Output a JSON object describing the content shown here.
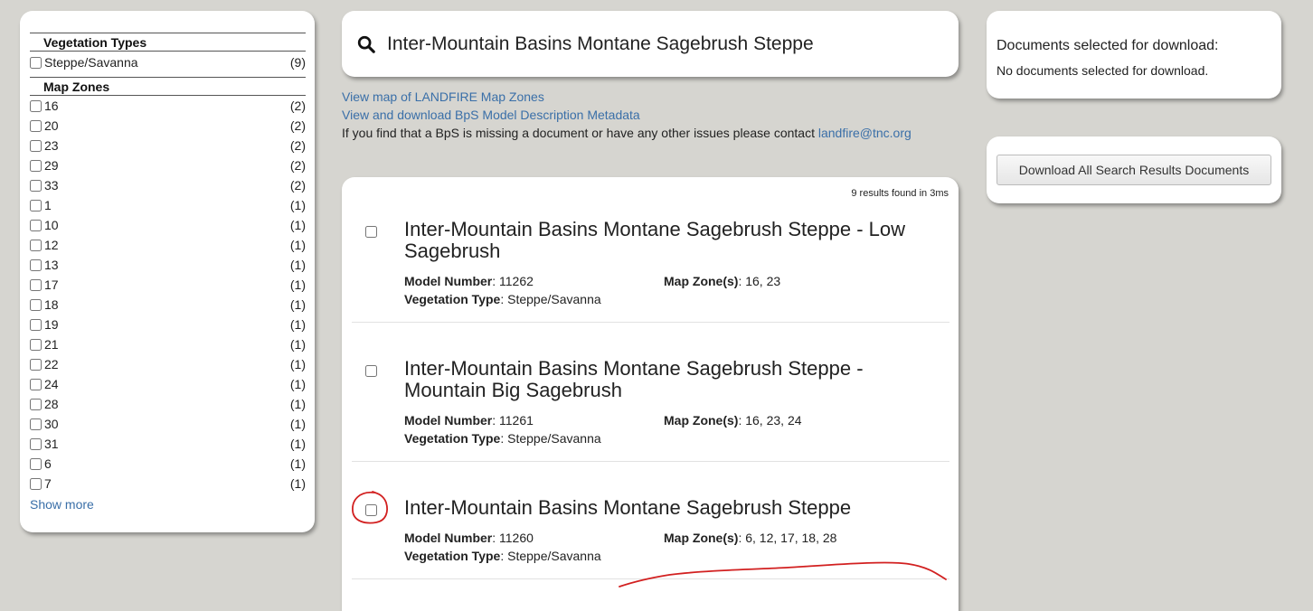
{
  "facets": {
    "vegetation_title": "Vegetation Types",
    "vegetation_items": [
      {
        "label": "Steppe/Savanna",
        "count": "(9)"
      }
    ],
    "mapzones_title": "Map Zones",
    "mapzone_items": [
      {
        "label": "16",
        "count": "(2)"
      },
      {
        "label": "20",
        "count": "(2)"
      },
      {
        "label": "23",
        "count": "(2)"
      },
      {
        "label": "29",
        "count": "(2)"
      },
      {
        "label": "33",
        "count": "(2)"
      },
      {
        "label": "1",
        "count": "(1)"
      },
      {
        "label": "10",
        "count": "(1)"
      },
      {
        "label": "12",
        "count": "(1)"
      },
      {
        "label": "13",
        "count": "(1)"
      },
      {
        "label": "17",
        "count": "(1)"
      },
      {
        "label": "18",
        "count": "(1)"
      },
      {
        "label": "19",
        "count": "(1)"
      },
      {
        "label": "21",
        "count": "(1)"
      },
      {
        "label": "22",
        "count": "(1)"
      },
      {
        "label": "24",
        "count": "(1)"
      },
      {
        "label": "28",
        "count": "(1)"
      },
      {
        "label": "30",
        "count": "(1)"
      },
      {
        "label": "31",
        "count": "(1)"
      },
      {
        "label": "6",
        "count": "(1)"
      },
      {
        "label": "7",
        "count": "(1)"
      }
    ],
    "show_more": "Show more"
  },
  "search": {
    "value": "Inter-Mountain Basins Montane Sagebrush Steppe",
    "icon": "search-icon"
  },
  "links": {
    "map_zones": "View map of LANDFIRE Map Zones",
    "metadata": "View and download BpS Model Description Metadata",
    "contact_text": "If you find that a BpS is missing a document or have any other issues please contact ",
    "contact_email": "landfire@tnc.org"
  },
  "results": {
    "count_text": "9 results found in 3ms",
    "labels": {
      "model_number": "Model Number",
      "vegetation_type": "Vegetation Type",
      "map_zones": "Map Zone(s)"
    },
    "items": [
      {
        "title": "Inter-Mountain Basins Montane Sagebrush Steppe - Low Sagebrush",
        "model_number": "11262",
        "map_zones": "16, 23",
        "vegetation_type": "Steppe/Savanna"
      },
      {
        "title": "Inter-Mountain Basins Montane Sagebrush Steppe - Mountain Big Sagebrush",
        "model_number": "11261",
        "map_zones": "16, 23, 24",
        "vegetation_type": "Steppe/Savanna"
      },
      {
        "title": "Inter-Mountain Basins Montane Sagebrush Steppe",
        "model_number": "11260",
        "map_zones": "6, 12, 17, 18, 28",
        "vegetation_type": "Steppe/Savanna"
      }
    ]
  },
  "download_selected": {
    "heading": "Documents selected for download:",
    "empty": "No documents selected for download."
  },
  "download_all": {
    "button": "Download All Search Results Documents"
  },
  "colors": {
    "background": "#d6d5d0",
    "link": "#3a6fa8",
    "annotation": "#d22020"
  }
}
